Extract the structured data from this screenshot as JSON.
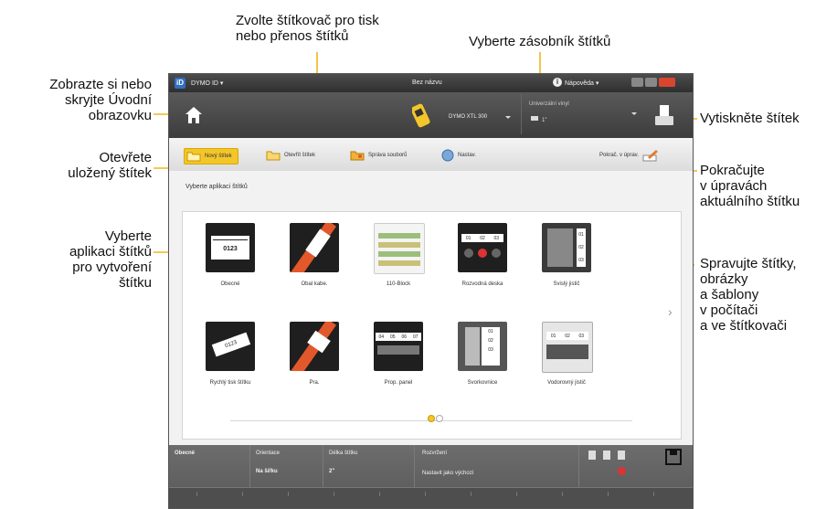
{
  "callouts": {
    "select_printer": [
      "Zvolte štítkovač pro tisk",
      "nebo přenos štítků"
    ],
    "select_cassette": "Vyberte zásobník štítků",
    "home_screen": [
      "Zobrazte si nebo",
      "skryjte Úvodní",
      "obrazovku"
    ],
    "print_label": "Vytiskněte štítek",
    "open_saved": [
      "Otevřete",
      "uložený štítek"
    ],
    "continue_edit": [
      "Pokračujte",
      "v úpravách",
      "aktuálního štítku"
    ],
    "select_app": [
      "Vyberte",
      "aplikaci štítků",
      "pro vytvoření",
      "štítku"
    ],
    "manage_files": [
      "Spravujte štítky,",
      "obrázky",
      "a šablony",
      "v počítači",
      "a ve štítkovači"
    ]
  },
  "window": {
    "app_name": "DYMO ID ▾",
    "doc_title": "Bez názvu",
    "help": "Nápověda ▾",
    "printer_name": "DYMO XTL 300",
    "cartridge_title": "Univerzální vinyl",
    "cartridge_value": "1\""
  },
  "toolbar": {
    "new_label": "Nový štítek",
    "open_label": "Otevřít štítek",
    "file_manager": "Správa souborů",
    "settings": "Nastav.",
    "continue_edit": "Pokrač. v úprav."
  },
  "content": {
    "heading": "Vyberte aplikaci štítků",
    "tiles": [
      {
        "label": "Obecné"
      },
      {
        "label": "Obal kabe."
      },
      {
        "label": "110-Block"
      },
      {
        "label": "Rozvodná deska"
      },
      {
        "label": "Svislý jistič"
      },
      {
        "label": "Rychlý tisk štítku"
      },
      {
        "label": "Pra."
      },
      {
        "label": "Prop. panel"
      },
      {
        "label": "Svorkovnice"
      },
      {
        "label": "Vodorovný jistič"
      }
    ],
    "general_code": "0123",
    "breaker_numbers": [
      "01",
      "02",
      "03"
    ],
    "panel_numbers": [
      "04",
      "05",
      "06",
      "07"
    ]
  },
  "props": {
    "section": "Obecné",
    "orientation_label": "Orientace",
    "orientation_value": "Na šířku",
    "length_label": "Délka štítku",
    "length_value": "2\"",
    "layout_label": "Rozvržení",
    "layout_default": "Nastavit jako výchozí"
  },
  "colors": {
    "accent": "#f3c62a",
    "callout_line": "#f2b51c",
    "titlebar": "#3a3a3a",
    "close_button": "#d9462f"
  }
}
